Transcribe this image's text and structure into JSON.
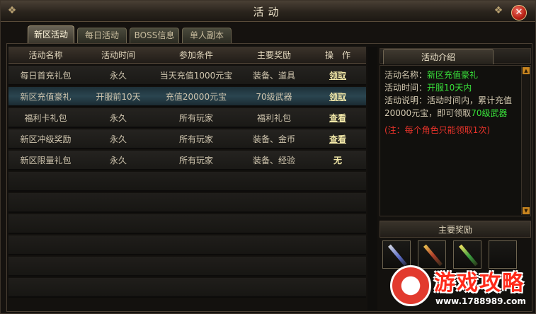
{
  "window": {
    "title": "活动"
  },
  "tabs": [
    {
      "label": "新区活动",
      "active": true
    },
    {
      "label": "每日活动",
      "active": false
    },
    {
      "label": "BOSS信息",
      "active": false
    },
    {
      "label": "单人副本",
      "active": false
    }
  ],
  "table": {
    "headers": [
      "活动名称",
      "活动时间",
      "参加条件",
      "主要奖励",
      "操　作"
    ],
    "rows": [
      {
        "name": "每日首充礼包",
        "time": "永久",
        "condition": "当天充值1000元宝",
        "reward": "装备、道具",
        "action": "领取",
        "selected": false
      },
      {
        "name": "新区充值豪礼",
        "time": "开服前10天",
        "condition": "充值20000元宝",
        "reward": "70级武器",
        "action": "领取",
        "selected": true
      },
      {
        "name": "福利卡礼包",
        "time": "永久",
        "condition": "所有玩家",
        "reward": "福利礼包",
        "action": "查看",
        "selected": false
      },
      {
        "name": "新区冲级奖励",
        "time": "永久",
        "condition": "所有玩家",
        "reward": "装备、金币",
        "action": "查看",
        "selected": false
      },
      {
        "name": "新区限量礼包",
        "time": "永久",
        "condition": "所有玩家",
        "reward": "装备、经验",
        "action": "无",
        "selected": false
      }
    ]
  },
  "side": {
    "tab_label": "活动介绍",
    "desc": {
      "name_label": "活动名称：",
      "name_value": "新区充值豪礼",
      "time_label": "活动时间：",
      "time_value": "开服10天内",
      "explain_label": "活动说明：",
      "explain_text1": "活动时间内，累计充值",
      "explain_text2": "20000元宝，即可领取",
      "explain_value": "70级武器",
      "note": "(注：每个角色只能领取1次)"
    },
    "reward_title": "主要奖励",
    "reward_icons": [
      "sword-icon",
      "staff-icon",
      "staff-green-icon",
      "empty-slot"
    ]
  },
  "watermark": {
    "title": "游戏攻略",
    "url": "www.1788989.com"
  },
  "colors": {
    "accent_green": "#39e23a",
    "note_red": "#e8332a",
    "action_gold": "#f2e8a8"
  }
}
